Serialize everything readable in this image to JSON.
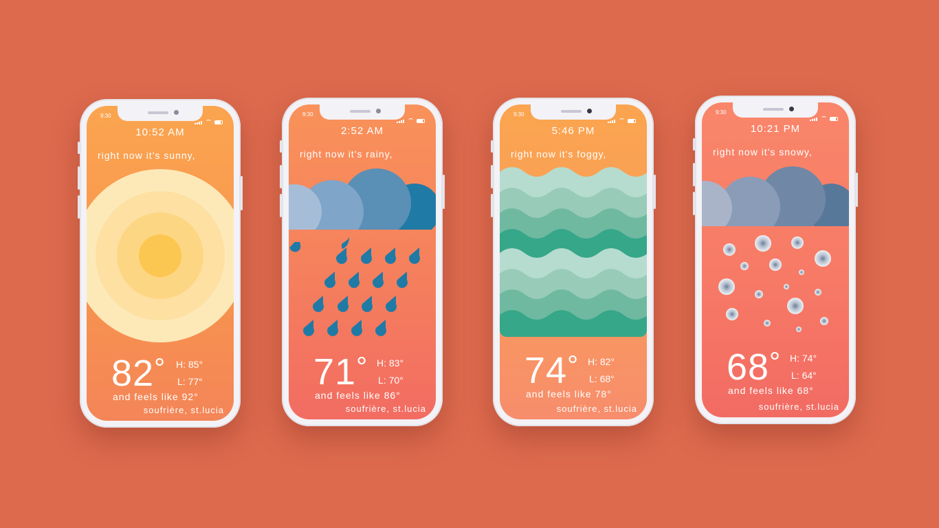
{
  "background_color": "#dd6a4d",
  "phones": [
    {
      "status_time": "9:30",
      "clock": "10:52 AM",
      "condition": "right now it's sunny,",
      "temp": "82",
      "degree": "°",
      "high": "H: 85°",
      "low": "L: 77°",
      "feels": "and feels like 92°",
      "location": "soufrière, st.lucia",
      "art_icon": "sun-icon",
      "gradient": [
        "#fba54f",
        "#f48558"
      ]
    },
    {
      "status_time": "9:30",
      "clock": "2:52 AM",
      "condition": "right now it's rainy,",
      "temp": "71",
      "degree": "°",
      "high": "H: 83°",
      "low": "L: 70°",
      "feels": "and feels like 86°",
      "location": "soufrière, st.lucia",
      "art_icon": "rain-cloud-icon",
      "gradient": [
        "#f9925a",
        "#f26c62"
      ]
    },
    {
      "status_time": "9:30",
      "clock": "5:46 PM",
      "condition": "right now it's foggy,",
      "temp": "74",
      "degree": "°",
      "high": "H: 82°",
      "low": "L: 68°",
      "feels": "and feels like 78°",
      "location": "soufrière, st.lucia",
      "art_icon": "fog-waves-icon",
      "gradient": [
        "#fba54f",
        "#f78d6c"
      ]
    },
    {
      "status_time": "9:30",
      "clock": "10:21 PM",
      "condition": "right now it's snowy,",
      "temp": "68",
      "degree": "°",
      "high": "H: 74°",
      "low": "L: 64°",
      "feels": "and feels like 68°",
      "location": "soufrière, st.lucia",
      "art_icon": "snow-cloud-icon",
      "gradient": [
        "#f9866a",
        "#f26b63"
      ]
    }
  ]
}
